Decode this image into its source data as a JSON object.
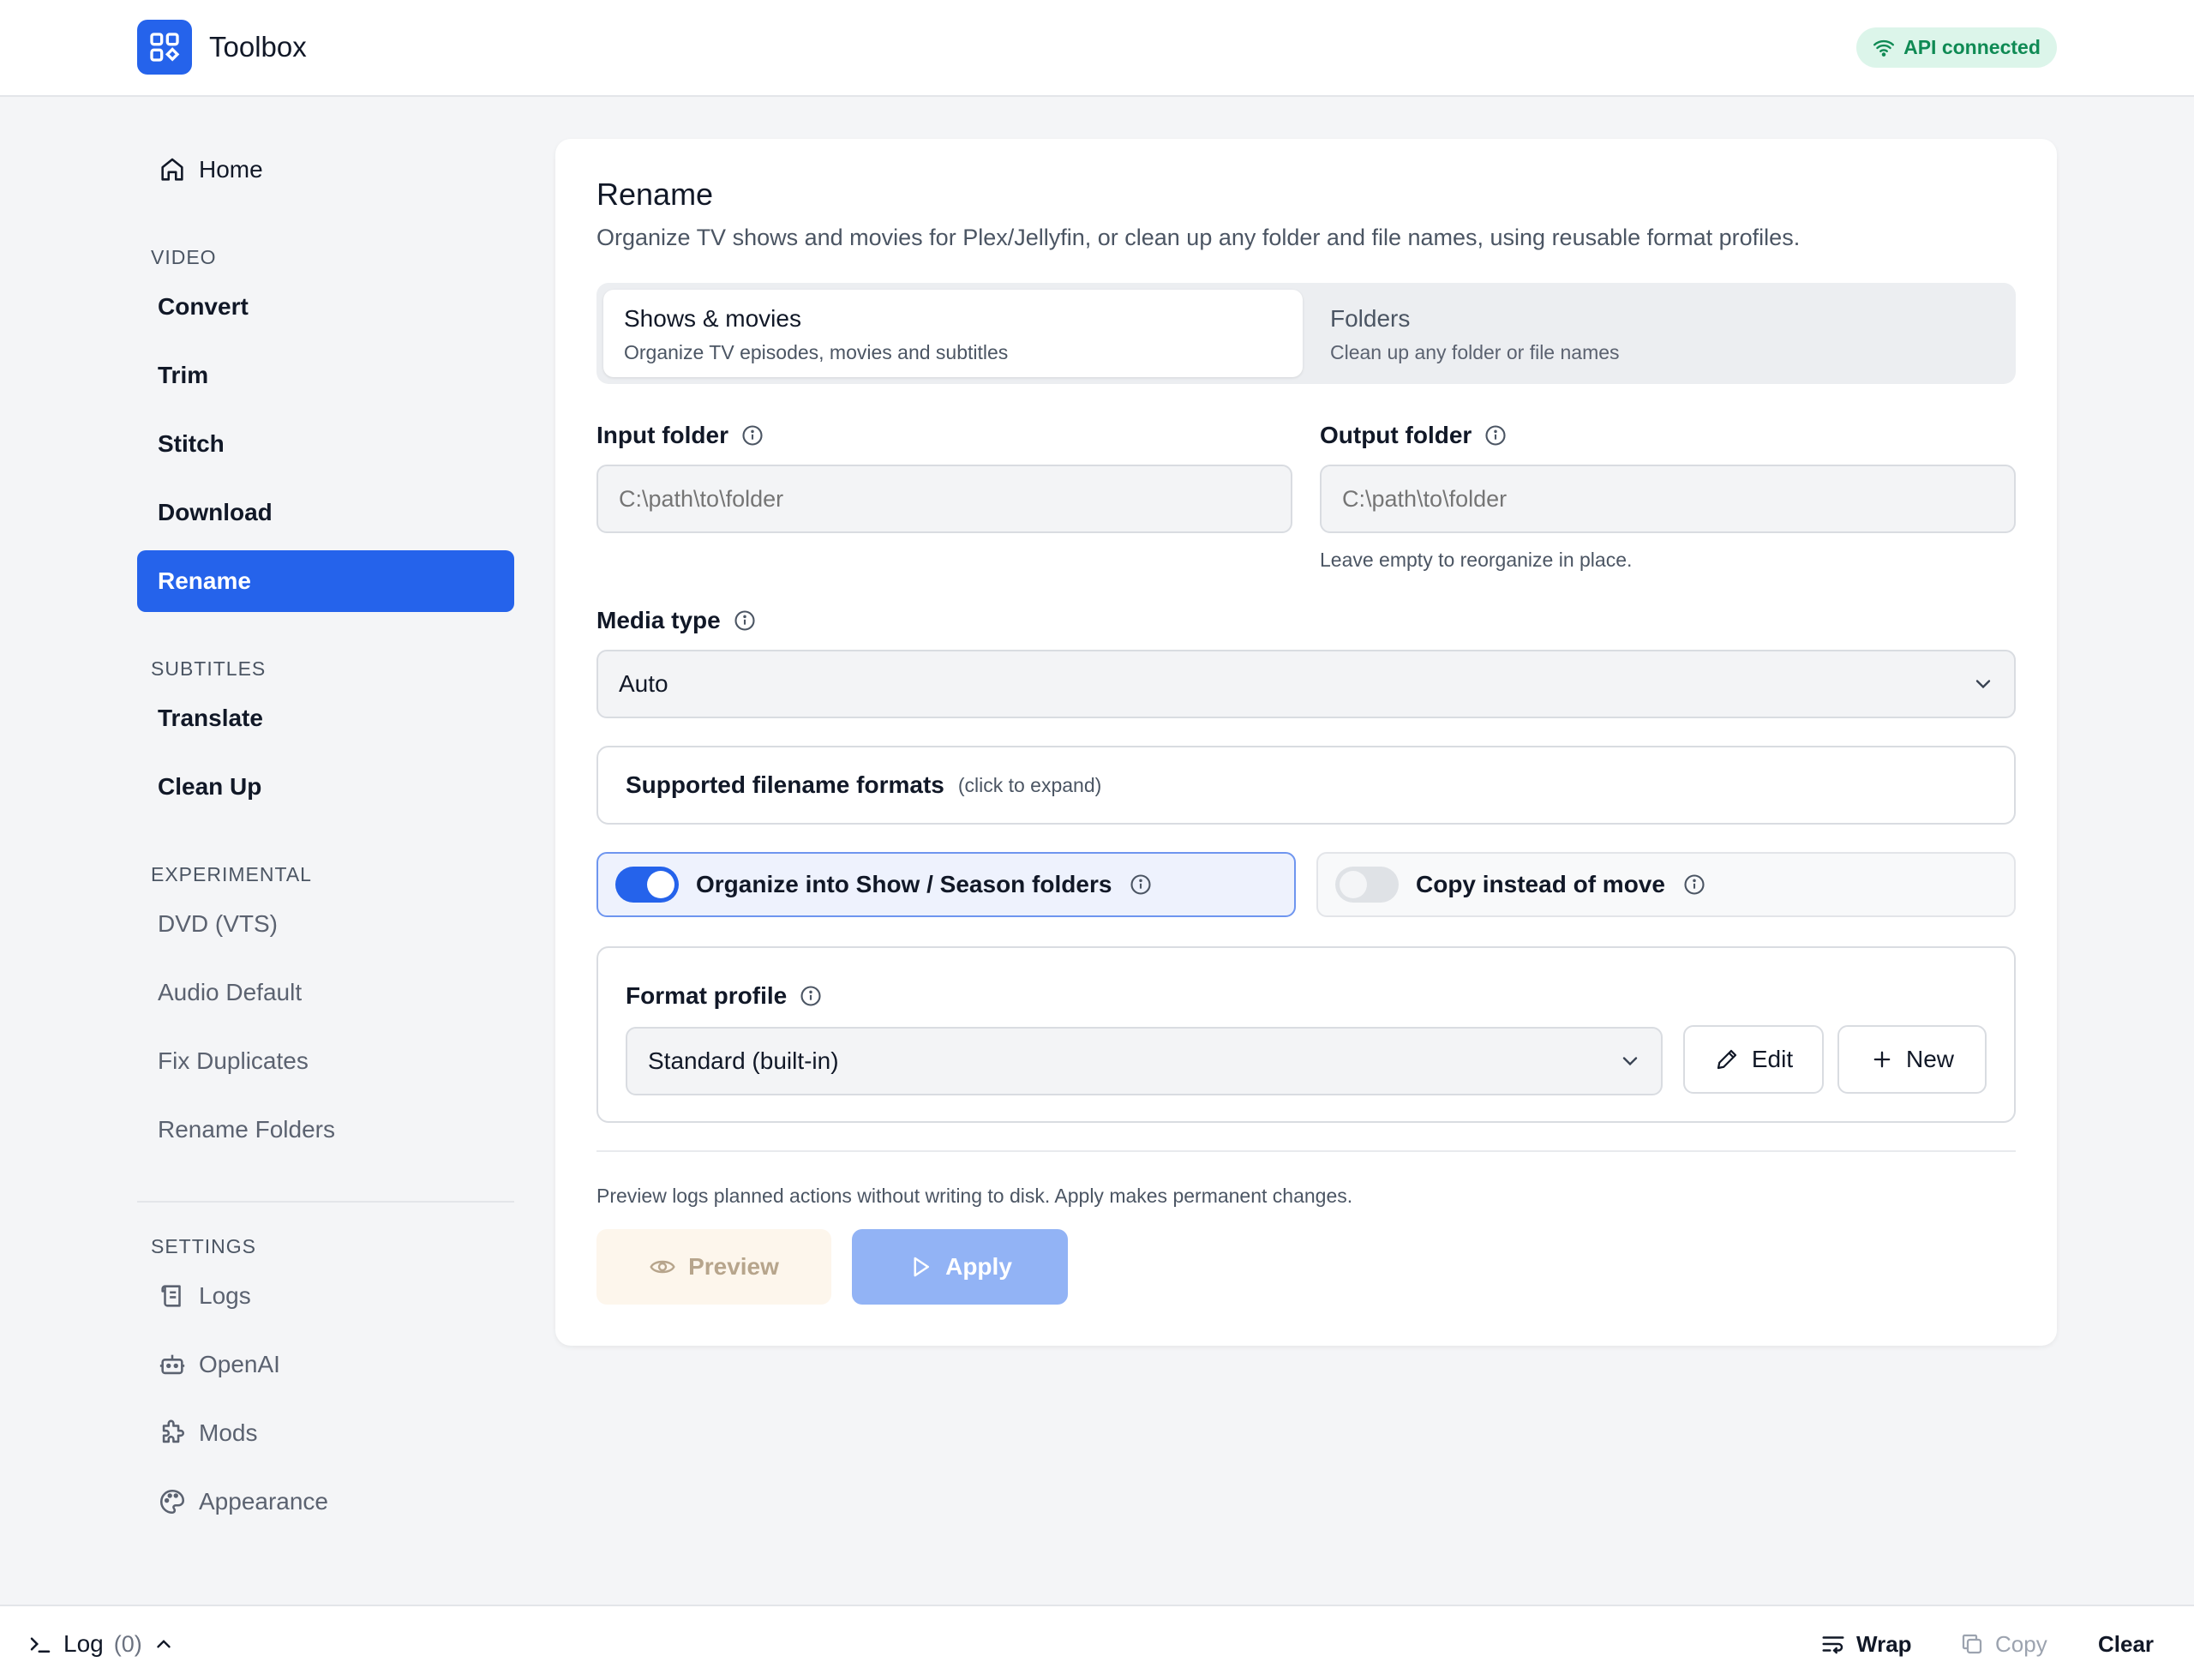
{
  "header": {
    "app_title": "Toolbox",
    "api_status": "API connected",
    "brand_color": "#2563eb",
    "status_color": "#0f8a54"
  },
  "sidebar": {
    "home": "Home",
    "sections": {
      "video": "VIDEO",
      "subtitles": "SUBTITLES",
      "experimental": "EXPERIMENTAL",
      "settings": "SETTINGS"
    },
    "video_items": [
      "Convert",
      "Trim",
      "Stitch",
      "Download",
      "Rename"
    ],
    "subtitle_items": [
      "Translate",
      "Clean Up"
    ],
    "experimental_items": [
      "DVD (VTS)",
      "Audio Default",
      "Fix Duplicates",
      "Rename Folders"
    ],
    "settings_items": [
      {
        "label": "Logs",
        "icon": "logs-icon"
      },
      {
        "label": "OpenAI",
        "icon": "robot-icon"
      },
      {
        "label": "Mods",
        "icon": "puzzle-icon"
      },
      {
        "label": "Appearance",
        "icon": "palette-icon"
      }
    ],
    "active_item": "Rename"
  },
  "main": {
    "title": "Rename",
    "subtitle": "Organize TV shows and movies for Plex/Jellyfin, or clean up any folder and file names, using reusable format profiles.",
    "tabs": [
      {
        "label": "Shows & movies",
        "desc": "Organize TV episodes, movies and subtitles",
        "selected": true
      },
      {
        "label": "Folders",
        "desc": "Clean up any folder or file names",
        "selected": false
      }
    ],
    "input_folder": {
      "label": "Input folder",
      "value": "",
      "placeholder": "C:\\path\\to\\folder"
    },
    "output_folder": {
      "label": "Output folder",
      "value": "",
      "placeholder": "C:\\path\\to\\folder",
      "hint": "Leave empty to reorganize in place."
    },
    "media_type": {
      "label": "Media type",
      "value": "Auto"
    },
    "formats_expander": {
      "title": "Supported filename formats",
      "hint": "(click to expand)"
    },
    "toggles": [
      {
        "label": "Organize into Show / Season folders",
        "on": true
      },
      {
        "label": "Copy instead of move",
        "on": false
      }
    ],
    "format_profile": {
      "label": "Format profile",
      "value": "Standard (built-in)",
      "edit_label": "Edit",
      "new_label": "New"
    },
    "footnote": "Preview logs planned actions without writing to disk. Apply makes permanent changes.",
    "preview_label": "Preview",
    "apply_label": "Apply"
  },
  "logbar": {
    "label": "Log",
    "count": "(0)",
    "wrap_label": "Wrap",
    "copy_label": "Copy",
    "clear_label": "Clear"
  }
}
